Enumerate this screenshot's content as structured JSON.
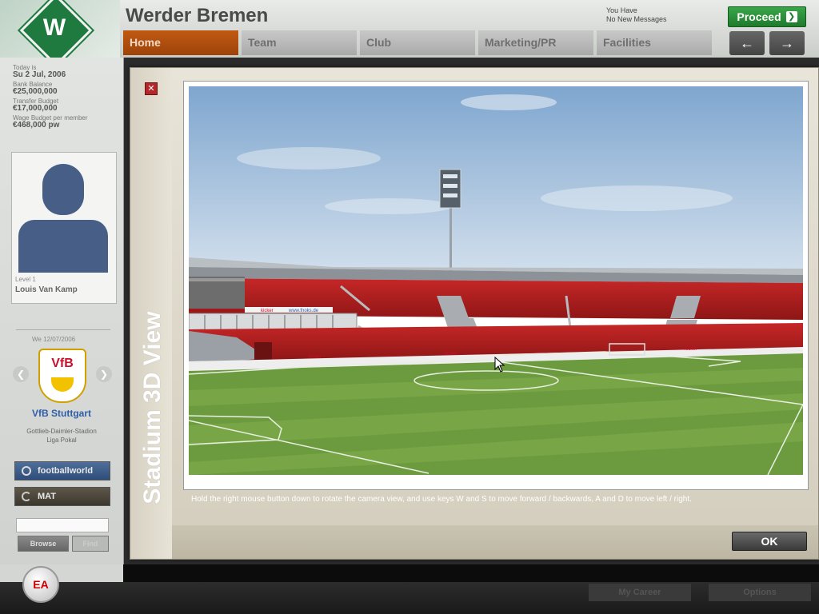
{
  "header": {
    "club_name": "Werder Bremen",
    "messages_line1": "You Have",
    "messages_line2": "No New Messages",
    "proceed_label": "Proceed",
    "tabs": [
      {
        "label": "Home"
      },
      {
        "label": "Team"
      },
      {
        "label": "Club"
      },
      {
        "label": "Marketing/PR"
      },
      {
        "label": "Facilities"
      }
    ],
    "back_symbol": "←",
    "forward_symbol": "→"
  },
  "sidebar": {
    "date_label": "Today is",
    "date_value": "Su 2 Jul, 2006",
    "bank_label": "Bank Balance",
    "bank_value": "€25,000,000",
    "transfer_label": "Transfer Budget",
    "transfer_value": "€17,000,000",
    "wage_label": "Wage Budget per member",
    "wage_value": "€468,000 pw",
    "manager_level": "Level 1",
    "manager_name": "Louis Van Kamp",
    "next_match": "We 12/07/2006",
    "opponent_name": "VfB Stuttgart",
    "opponent_info_line1": "Gottlieb-Daimler-Stadion",
    "opponent_info_line2": "Liga Pokal",
    "footballworld_label": "footballworld",
    "mat_label": "MAT",
    "browse_label": "Browse",
    "find_label": "Find"
  },
  "footer": {
    "ea_label": "EA",
    "my_career_label": "My Career",
    "options_label": "Options"
  },
  "modal": {
    "title": "Stadium 3D View",
    "close_symbol": "✕",
    "instructions": "Hold the right mouse button down to rotate the camera view, and use keys W and S to move forward / backwards, A and D to move left / right.",
    "ok_label": "OK",
    "ad_board_texts": [
      "kicker",
      "www.fnoks.de"
    ]
  },
  "colors": {
    "accent_orange": "#b04f10",
    "proceed_green": "#2a9a3a",
    "stand_red": "#b01f1f",
    "pitch_green": "#6a9a3c",
    "sky_blue": "#8fb3d6"
  }
}
